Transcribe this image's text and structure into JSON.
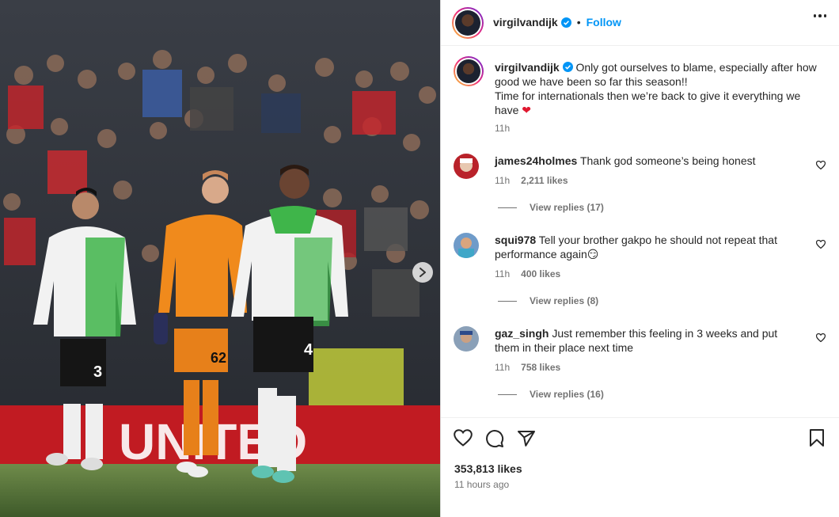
{
  "post": {
    "username": "virgilvandijk",
    "follow_label": "Follow",
    "separator": "•",
    "caption_line1": "Only got ourselves to blame, especially after how good we have been so far this season!!",
    "caption_line2": "Time for internationals then we’re back to give it everything we have",
    "caption_emoji": "❤",
    "caption_time": "11h",
    "likes": "353,813 likes",
    "posted_ago": "11 hours ago"
  },
  "comments": [
    {
      "username": "james24holmes",
      "text": "Thank god someone’s being honest",
      "time": "11h",
      "likes": "2,211 likes",
      "replies": "View replies (17)"
    },
    {
      "username": "squi978",
      "text": "Tell your brother gakpo he should not repeat that performance again😏",
      "time": "11h",
      "likes": "400 likes",
      "replies": "View replies (8)"
    },
    {
      "username": "gaz_singh",
      "text": "Just remember this feeling in 3 weeks and put them in their place next time",
      "time": "11h",
      "likes": "758 likes",
      "replies": "View replies (16)"
    }
  ],
  "photo": {
    "jersey_numbers": [
      "3",
      "62",
      "4"
    ],
    "banner_text": "UNITED"
  },
  "colors": {
    "accent": "#0095f6",
    "kit_green": "#3fb54a",
    "keeper_orange": "#f08a1c"
  },
  "icons": [
    "verified-icon",
    "more-options-icon",
    "like-icon",
    "comment-icon",
    "share-icon",
    "bookmark-icon",
    "next-photo-icon"
  ]
}
